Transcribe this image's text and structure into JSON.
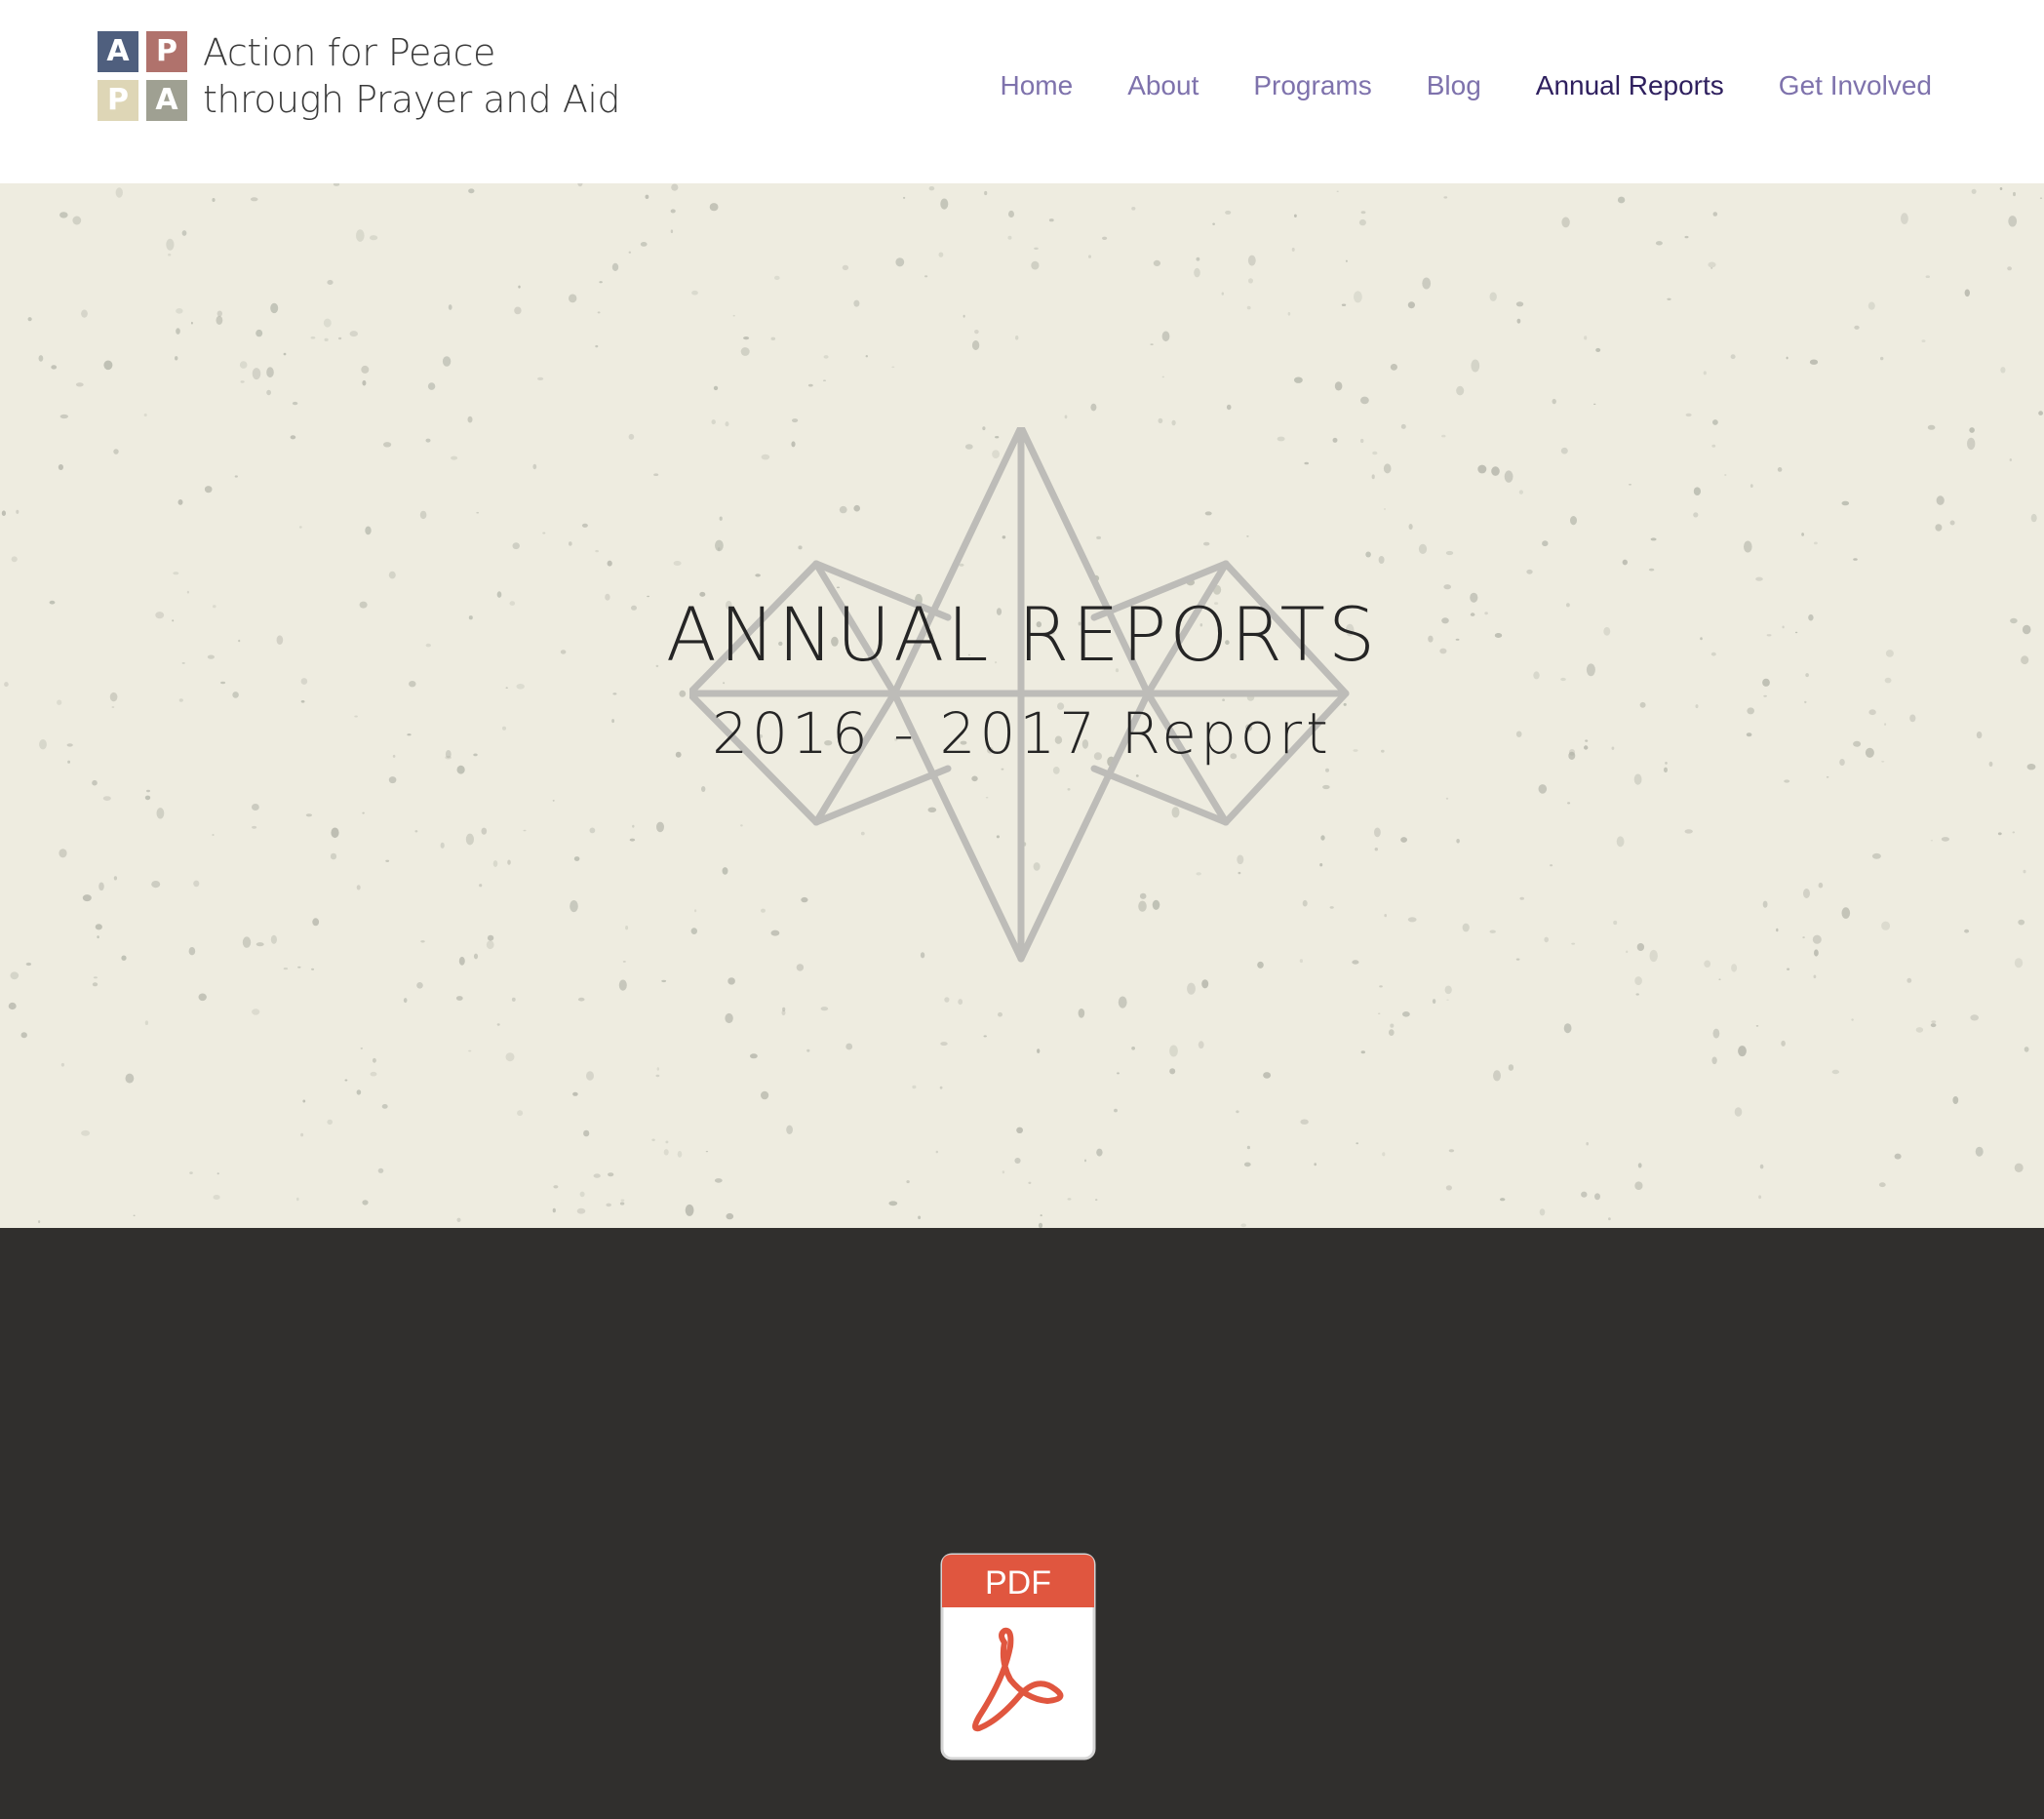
{
  "brand": {
    "logo_letters": [
      "A",
      "P",
      "P",
      "A"
    ],
    "logo_colors": [
      "#4f5f7e",
      "#b0726c",
      "#ded6b6",
      "#9fa092"
    ],
    "name_line1": "Action for Peace",
    "name_line2": "through Prayer and Aid"
  },
  "nav": {
    "items": [
      {
        "label": "Home",
        "active": false
      },
      {
        "label": "About",
        "active": false
      },
      {
        "label": "Programs",
        "active": false
      },
      {
        "label": "Blog",
        "active": false
      },
      {
        "label": "Annual Reports",
        "active": true
      },
      {
        "label": "Get Involved",
        "active": false
      }
    ],
    "link_color": "#7e72ac",
    "active_color": "#2e1f5e"
  },
  "hero": {
    "title": "ANNUAL REPORTS",
    "subtitle": "2016 - 2017 Report",
    "background_color": "#eeece0",
    "decoration_icon": "star-outline-icon"
  },
  "download": {
    "icon": "pdf-icon",
    "badge_label": "PDF",
    "badge_color": "#e0563f",
    "section_background": "#302f2d"
  }
}
